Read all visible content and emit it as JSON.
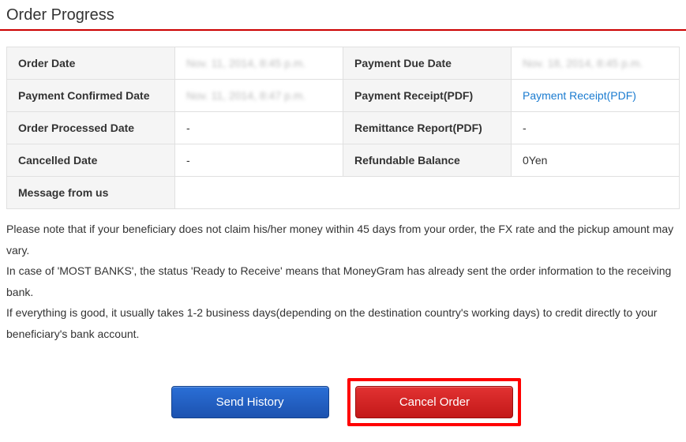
{
  "title": "Order Progress",
  "rows": [
    {
      "label1": "Order Date",
      "value1": "Nov. 11, 2014, 8:45 p.m.",
      "value1_blurred": true,
      "label2": "Payment Due Date",
      "value2": "Nov. 18, 2014, 8:45 p.m.",
      "value2_blurred": true
    },
    {
      "label1": "Payment Confirmed Date",
      "value1": "Nov. 11, 2014, 8:47 p.m.",
      "value1_blurred": true,
      "label2": "Payment Receipt(PDF)",
      "value2_link": "Payment Receipt(PDF)"
    },
    {
      "label1": "Order Processed Date",
      "value1": "-",
      "label2": "Remittance Report(PDF)",
      "value2": "-"
    },
    {
      "label1": "Cancelled Date",
      "value1": "-",
      "label2": "Refundable Balance",
      "value2": "0Yen"
    },
    {
      "label1": "Message from us",
      "full_row": true,
      "value1": ""
    }
  ],
  "notes": [
    "Please note that if your beneficiary does not claim his/her money within 45 days from your order, the FX rate and the pickup amount may vary.",
    "In case of 'MOST BANKS', the status 'Ready to Receive' means that MoneyGram has already sent the order information to the receiving bank.",
    "If everything is good, it usually takes 1-2 business days(depending on the destination country's working days) to credit directly to your beneficiary's bank account."
  ],
  "buttons": {
    "send_history": "Send History",
    "cancel_order": "Cancel Order"
  }
}
